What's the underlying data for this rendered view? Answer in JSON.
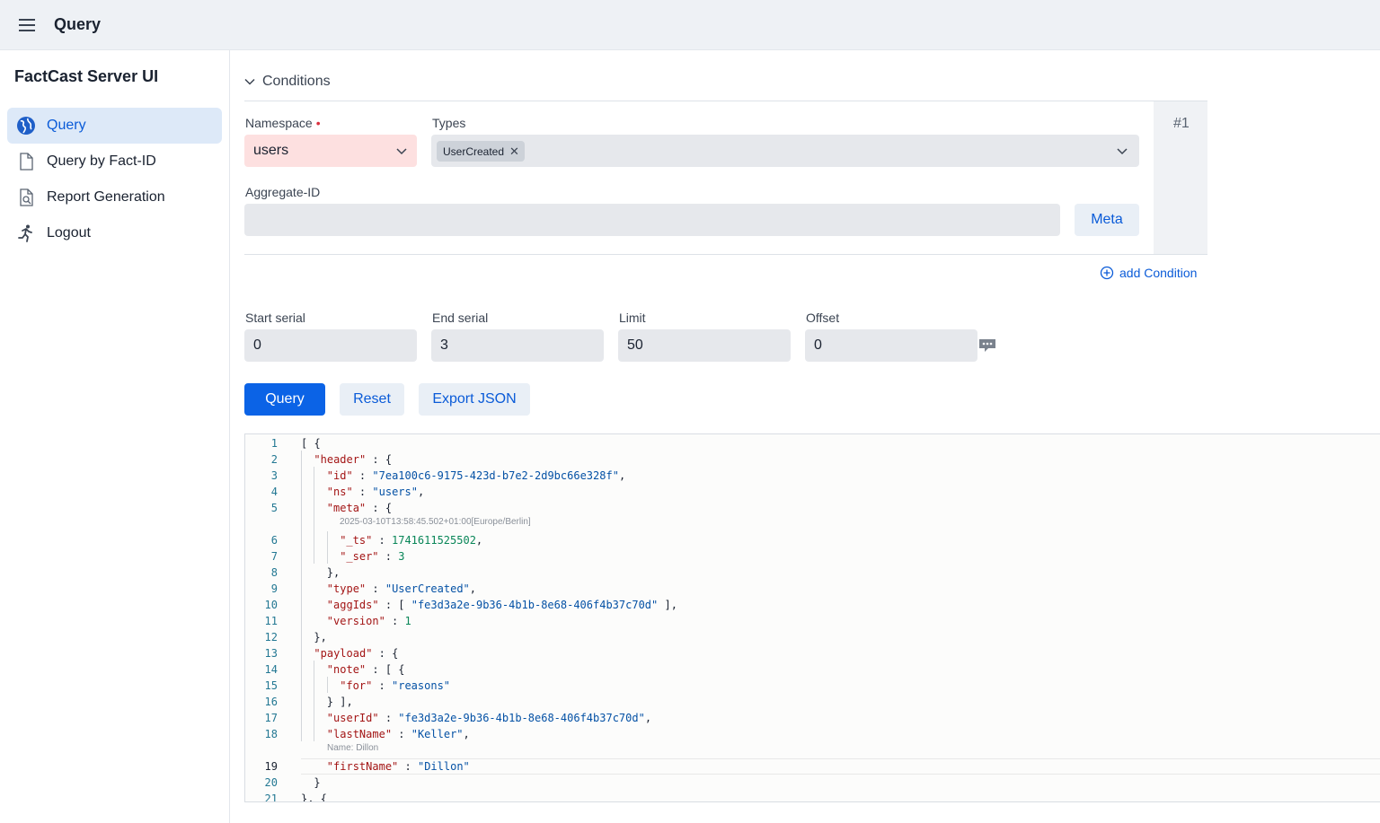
{
  "topbar": {
    "title": "Query",
    "menu_icon": "hamburger-menu-icon"
  },
  "sidebar": {
    "app_name": "FactCast Server UI",
    "items": [
      {
        "label": "Query",
        "icon": "globe-icon",
        "active": true
      },
      {
        "label": "Query by Fact-ID",
        "icon": "file-icon",
        "active": false
      },
      {
        "label": "Report Generation",
        "icon": "file-search-icon",
        "active": false
      },
      {
        "label": "Logout",
        "icon": "running-person-icon",
        "active": false
      }
    ]
  },
  "conditions": {
    "header": "Conditions",
    "index_label": "#1",
    "namespace_label": "Namespace",
    "required_marker": "•",
    "namespace_value": "users",
    "types_label": "Types",
    "types_chip": "UserCreated",
    "chip_remove": "✕",
    "aggregate_label": "Aggregate-ID",
    "aggregate_value": "",
    "meta_button": "Meta",
    "add_condition": "add Condition"
  },
  "range": {
    "start_label": "Start serial",
    "start_value": "0",
    "end_label": "End serial",
    "end_value": "3",
    "limit_label": "Limit",
    "limit_value": "50",
    "offset_label": "Offset",
    "offset_value": "0"
  },
  "buttons": {
    "query": "Query",
    "reset": "Reset",
    "export": "Export JSON"
  },
  "editor": {
    "current_line": "19",
    "lines": [
      {
        "n": "1",
        "t": "[ {"
      },
      {
        "n": "2",
        "t": "\"header\" : {"
      },
      {
        "n": "3",
        "t": "\"id\" : \"7ea100c6-9175-423d-b7e2-2d9bc66e328f\","
      },
      {
        "n": "4",
        "t": "\"ns\" : \"users\","
      },
      {
        "n": "5",
        "t": "\"meta\" : {"
      },
      {
        "n": "6",
        "t": "\"_ts\" : 1741611525502,"
      },
      {
        "n": "7",
        "t": "\"_ser\" : 3"
      },
      {
        "n": "8",
        "t": "},"
      },
      {
        "n": "9",
        "t": "\"type\" : \"UserCreated\","
      },
      {
        "n": "10",
        "t": "\"aggIds\" : [ \"fe3d3a2e-9b36-4b1b-8e68-406f4b37c70d\" ],"
      },
      {
        "n": "11",
        "t": "\"version\" : 1"
      },
      {
        "n": "12",
        "t": "},"
      },
      {
        "n": "13",
        "t": "\"payload\" : {"
      },
      {
        "n": "14",
        "t": "\"note\" : [ {"
      },
      {
        "n": "15",
        "t": "\"for\" : \"reasons\""
      },
      {
        "n": "16",
        "t": "} ],"
      },
      {
        "n": "17",
        "t": "\"userId\" : \"fe3d3a2e-9b36-4b1b-8e68-406f4b37c70d\","
      },
      {
        "n": "18",
        "t": "\"lastName\" : \"Keller\","
      },
      {
        "n": "19",
        "t": "\"firstName\" : \"Dillon\""
      },
      {
        "n": "20",
        "t": "}"
      },
      {
        "n": "21",
        "t": "}, {"
      }
    ],
    "hints": {
      "ts": "2025-03-10T13:58:45.502+01:00[Europe/Berlin]",
      "name": "Name: Dillon"
    }
  }
}
